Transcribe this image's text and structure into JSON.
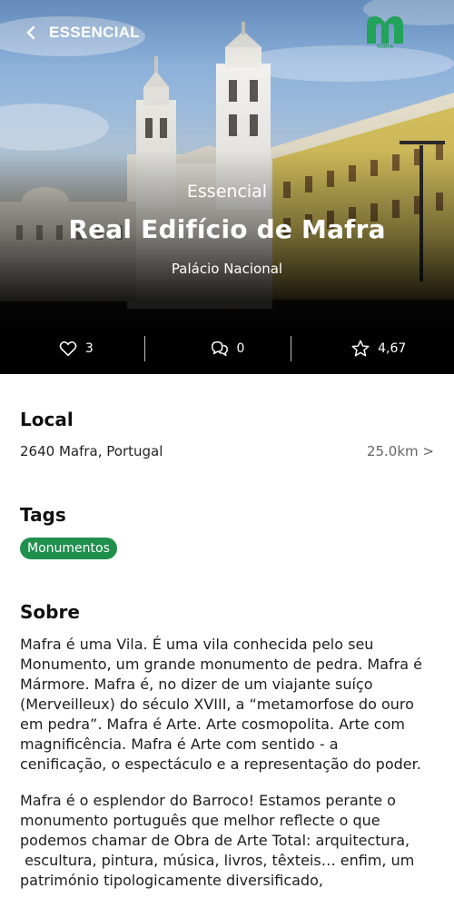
{
  "header": {
    "back_label": "ESSENCIAL",
    "logo_text": "Mafra"
  },
  "hero": {
    "kicker": "Essencial",
    "title": "Real Edifício de Mafra",
    "subtitle": "Palácio Nacional"
  },
  "stats": {
    "likes": "3",
    "comments": "0",
    "rating": "4,67"
  },
  "local": {
    "heading": "Local",
    "address": "2640 Mafra, Portugal",
    "distance": "25.0km >"
  },
  "tags": {
    "heading": "Tags",
    "items": [
      "Monumentos"
    ]
  },
  "sobre": {
    "heading": "Sobre",
    "paragraph_1_lines": [
      "Mafra é uma Vila. É uma vila conhecida pelo seu",
      "Monumento, um grande monumento de pedra. Mafra é",
      "Mármore. Mafra é, no dizer de um viajante suíço",
      "(Merveilleux) do século XVIII, a “metamorfose do ouro",
      "em pedra”. Mafra é Arte. Arte cosmopolita. Arte com",
      "magnificência. Mafra é Arte com sentido - a",
      "cenificação, o espectáculo e a representação do poder."
    ],
    "paragraph_2_lines": [
      "Mafra é o esplendor do Barroco! Estamos perante o",
      "monumento português que melhor reflecte  o que",
      "podemos chamar de Obra de Arte Total: arquitectura,",
      " escultura, pintura, música, livros, têxteis… enfim, um",
      "património tipologicamente diversificado,"
    ]
  },
  "colors": {
    "accent_green": "#1f8f4c",
    "logo_green": "#22a35a"
  }
}
